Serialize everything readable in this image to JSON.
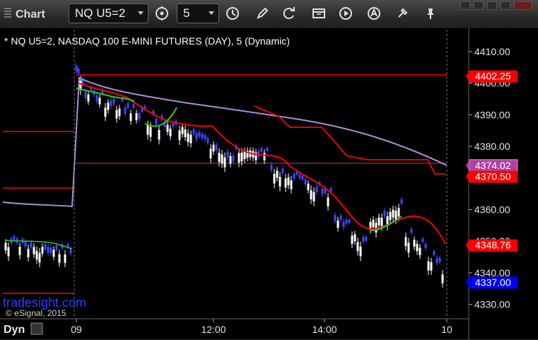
{
  "window": {
    "title": "Chart"
  },
  "toolbar": {
    "symbol": "NQ U5=2",
    "interval": "5",
    "icons": [
      "cycle-icon",
      "clock-icon",
      "pencil-icon",
      "refresh-icon",
      "calendar-icon",
      "play-icon",
      "alert-icon",
      "tools-icon",
      "pin-icon"
    ]
  },
  "chart": {
    "caption": "* NQ U5=2, NASDAQ 100 E-MINI FUTURES (DAY), 5 (Dynamic)",
    "watermark": "tradesight.com",
    "copyright": "© eSignal, 2015",
    "scale_mode": "Dyn",
    "y_ticks": [
      "4410.00",
      "4400.00",
      "4390.00",
      "4380.00",
      "4370.00",
      "4360.00",
      "4350.00",
      "4340.00",
      "4330.00"
    ],
    "x_ticks": [
      "09",
      "12:00",
      "14:00",
      "10"
    ],
    "price_tags": [
      {
        "label": "4402.25",
        "value": 4402.25,
        "color": "#ff0000"
      },
      {
        "label": "4374.02",
        "value": 4374.02,
        "color": "#b040a0"
      },
      {
        "label": "4370.50",
        "value": 4370.5,
        "color": "#ff0000"
      },
      {
        "label": "4348.76",
        "value": 4348.76,
        "color": "#ff0000"
      },
      {
        "label": "4337.00",
        "value": 4337.0,
        "color": "#0000ff"
      }
    ],
    "colors": {
      "up_bar": "#ffffff",
      "down_bar": "#3b48ff",
      "level_line": "#ff0000",
      "vwap": "#a98fd6",
      "ma_down": "#ff0000",
      "ma_up": "#22d022",
      "midline": "#8a1e5a"
    }
  }
}
